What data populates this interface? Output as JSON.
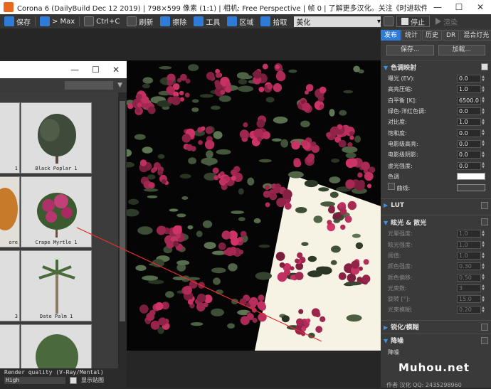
{
  "window": {
    "title": "Corona 6 (DailyBuild Dec 12 2019) | 798×599 像素 (1:1) | 相机: Free Perspective | 帧 0 | 了解更多汉化。关注《时进软件汉化》新浪微博 [R]",
    "minimize": "—",
    "maximize": "☐",
    "close": "✕"
  },
  "toolbar": {
    "save": "保存",
    "max": "> Max",
    "copy": "Ctrl+C",
    "refresh": "刷新",
    "delete": "擦除",
    "tools": "工具",
    "region": "区域",
    "pick": "拾取",
    "preset": "美化",
    "stop": "停止",
    "render": "渲染"
  },
  "library": {
    "minimize": "—",
    "maximize": "☐",
    "close": "✕",
    "items": [
      {
        "label": "1"
      },
      {
        "label": "Black Poplar 1"
      },
      {
        "label": "ore"
      },
      {
        "label": "Crape Myrtle 1"
      },
      {
        "label": "3"
      },
      {
        "label": "Date Palm 1"
      },
      {
        "label": ""
      },
      {
        "label": ""
      }
    ],
    "footer_title": "Render quality (V-Ray/Mental)",
    "quality_value": "High",
    "show_label": "显示贴图"
  },
  "panel": {
    "tabs": [
      "发布",
      "统计",
      "历史",
      "DR",
      "混合灯光"
    ],
    "save_btn": "保存...",
    "load_btn": "加载...",
    "tonemap": {
      "title": "色调映射",
      "rows": [
        {
          "label": "曝光 (EV):",
          "value": "0.0"
        },
        {
          "label": "高亮压缩:",
          "value": "1.0"
        },
        {
          "label": "白平衡 [K]:",
          "value": "6500.0"
        },
        {
          "label": "绿色-洋红色调:",
          "value": "0.0"
        },
        {
          "label": "对比度:",
          "value": "1.0"
        },
        {
          "label": "饱和度:",
          "value": "0.0"
        },
        {
          "label": "电影级高亮:",
          "value": "0.0"
        },
        {
          "label": "电影级阴影:",
          "value": "0.0"
        },
        {
          "label": "虚光强度:",
          "value": "0.0"
        }
      ],
      "color_label": "色调",
      "curve_label": "曲线:"
    },
    "lut": {
      "title": "LUT"
    },
    "bloom": {
      "title": "眩光 & 散光",
      "rows": [
        {
          "label": "光晕强度:",
          "value": "1.0"
        },
        {
          "label": "眩光强度:",
          "value": "1.0"
        },
        {
          "label": "阈值:",
          "value": "1.0"
        },
        {
          "label": "颜色强度:",
          "value": "0.30"
        },
        {
          "label": "颜色偏移:",
          "value": "0.50"
        },
        {
          "label": "光束数:",
          "value": "3"
        },
        {
          "label": "旋转 [°]:",
          "value": "15.0"
        },
        {
          "label": "光束模糊:",
          "value": "0.20"
        }
      ]
    },
    "sharpen": {
      "title": "锐化/模糊"
    },
    "denoise": {
      "title": "降噪",
      "row_label": "降噪"
    }
  },
  "watermark": "Muhou.net",
  "bottom_info": "作者 汉化 QQ: 2435298960"
}
